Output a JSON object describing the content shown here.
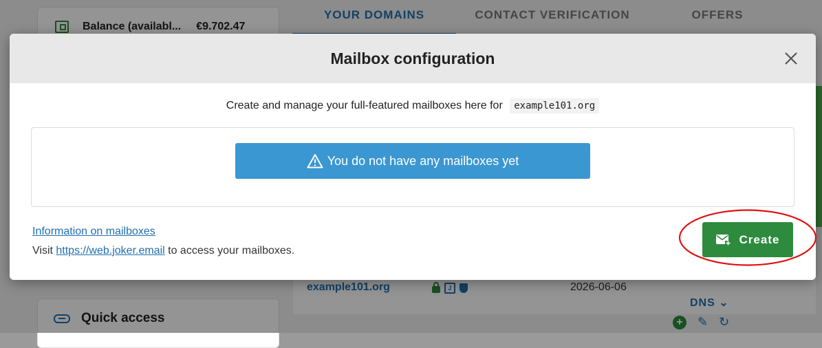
{
  "background": {
    "balance_label": "Balance (availabl...",
    "balance_amount": "€9.702.47",
    "tabs": [
      {
        "label": "YOUR DOMAINS",
        "active": true
      },
      {
        "label": "CONTACT VERIFICATION",
        "active": false
      },
      {
        "label": "OFFERS",
        "active": false
      }
    ],
    "domain_row": {
      "domain": "example101.org",
      "date": "2026-06-06",
      "dns_label": "DNS"
    },
    "quick_access_label": "Quick access"
  },
  "modal": {
    "title": "Mailbox configuration",
    "intro_text": "Create and manage your full-featured mailboxes here for",
    "domain": "example101.org",
    "empty_message": "You do not have any mailboxes yet",
    "info_link": "Information on mailboxes",
    "visit_prefix": "Visit",
    "visit_url": "https://web.joker.email",
    "visit_suffix": "to access your mailboxes.",
    "create_label": "Create"
  },
  "colors": {
    "accent_blue": "#1f6eae",
    "alert_blue": "#3a97d1",
    "create_green": "#2e8b3e",
    "highlight_red": "#e01010"
  },
  "icons": {
    "close": "close-icon",
    "warning": "warning-icon",
    "create": "mail-plus-icon"
  }
}
